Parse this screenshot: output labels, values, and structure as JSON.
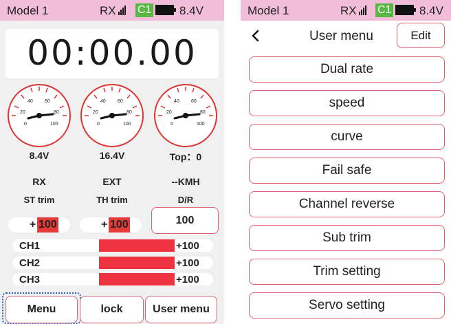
{
  "status": {
    "model": "Model 1",
    "rx": "RX",
    "channel": "C1",
    "battery": "8.4V",
    "colors": {
      "bar_bg": "#f2bdd9",
      "channel_badge": "#58b843"
    }
  },
  "home": {
    "timer": "00:00.00",
    "gauges": [
      {
        "value": "8.4V",
        "label": "RX",
        "ticks": [
          "20",
          "40",
          "60",
          "80",
          "100",
          "0"
        ]
      },
      {
        "value": "16.4V",
        "label": "EXT",
        "ticks": [
          "20",
          "40",
          "60",
          "80",
          "100",
          "0"
        ]
      },
      {
        "value": "Top：0",
        "label": "--KMH",
        "ticks": [
          "20",
          "40",
          "60",
          "80",
          "100",
          "0"
        ]
      }
    ],
    "trims": {
      "st": {
        "label": "ST trim",
        "sign": "+",
        "value": "100"
      },
      "th": {
        "label": "TH trim",
        "sign": "+",
        "value": "100"
      },
      "dr": {
        "label": "D/R",
        "value": "100"
      }
    },
    "channels": [
      {
        "name": "CH1",
        "value": "+100"
      },
      {
        "name": "CH2",
        "value": "+100"
      },
      {
        "name": "CH3",
        "value": "+100"
      }
    ],
    "buttons": {
      "menu": "Menu",
      "lock": "lock",
      "user_menu": "User menu"
    },
    "colors": {
      "accent": "#e0606f",
      "channel_bar": "#ef3340",
      "focus": "#2a63c7"
    }
  },
  "user_menu": {
    "back_icon": "chevron-left-icon",
    "title": "User menu",
    "edit": "Edit",
    "items": [
      "Dual rate",
      "speed",
      "curve",
      "Fail safe",
      "Channel reverse",
      "Sub trim",
      "Trim setting",
      "Servo setting"
    ]
  }
}
